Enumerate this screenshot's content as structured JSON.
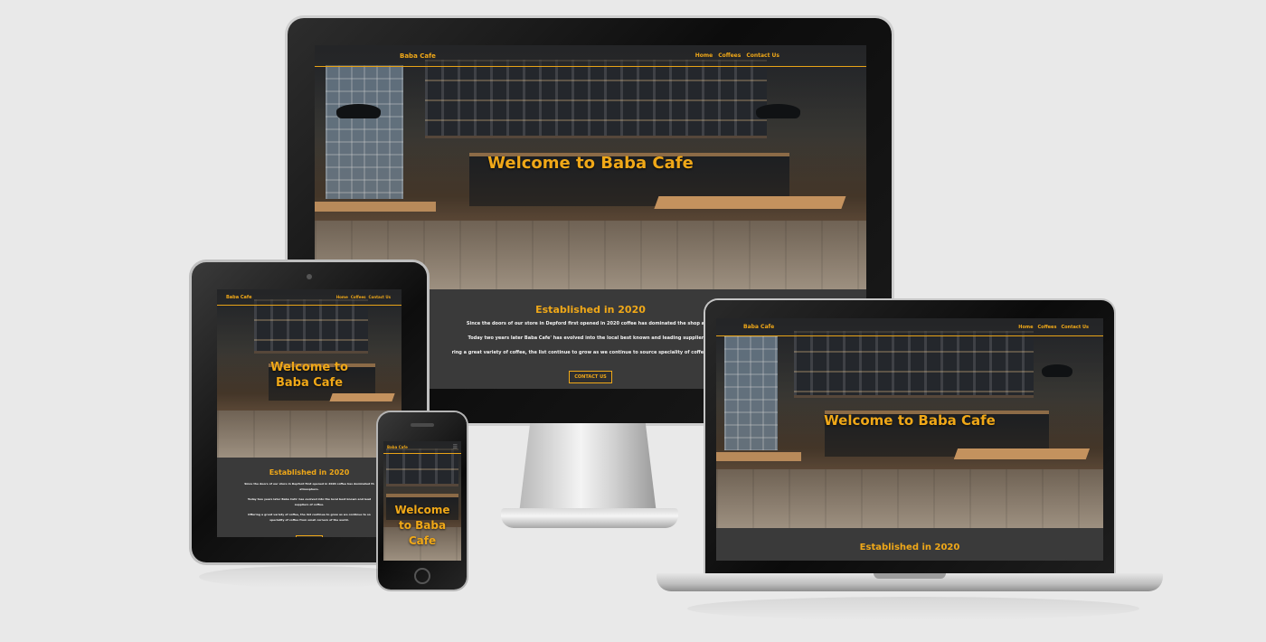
{
  "site": {
    "brand": "Baba Cafe",
    "nav": {
      "home": "Home",
      "coffees": "Coffees",
      "contact": "Contact Us"
    },
    "hero_title": "Welcome to Baba Cafe",
    "hero_title_tablet_line1": "Welcome to",
    "hero_title_tablet_line2": "Baba Cafe",
    "hero_title_phone_line1": "Welcome",
    "hero_title_phone_line2": "to Baba",
    "hero_title_phone_line3": "Cafe",
    "about_heading": "Established in 2020",
    "about_p1": "Since the doors of our store in Depford first opened in 2020 coffee has dominated the shop atmosphere.",
    "about_p2": "Today two years later Baba Cafe' has evolved into the local best known and leading suppliers of coffee.",
    "about_p3": "Offering a great variety of coffee, the list continue to grow as we continue to source speciality of coffee from small corners of the world.",
    "button": "CONTACT US"
  },
  "monitor": {
    "about_p1": "Since the doors of our store in Depford first opened in 2020 coffee has dominated the shop atmo",
    "about_p2": "Today two years later Baba Cafe' has evolved into the local best known and leading suppliers of",
    "about_p3": "ring a great variety of coffee, the list continue to grow as we continue to source speciality of coffee from sm"
  },
  "tablet": {
    "about_p1a": "Since the doors of our store in Depford first opened in 2020 coffee has dominated th",
    "about_p1b": "atmosphere.",
    "about_p2a": "Today two years later Baba Cafe' has evolved into the local best known and lead",
    "about_p2b": "suppliers of coffee.",
    "about_p3a": "Offering a great variety of coffee, the list continue to grow as we continue to so",
    "about_p3b": "speciality of coffee from small corners of the world."
  },
  "colors": {
    "accent": "#f0a818",
    "background": "#e9e9e9",
    "section": "#3a3a3a"
  }
}
